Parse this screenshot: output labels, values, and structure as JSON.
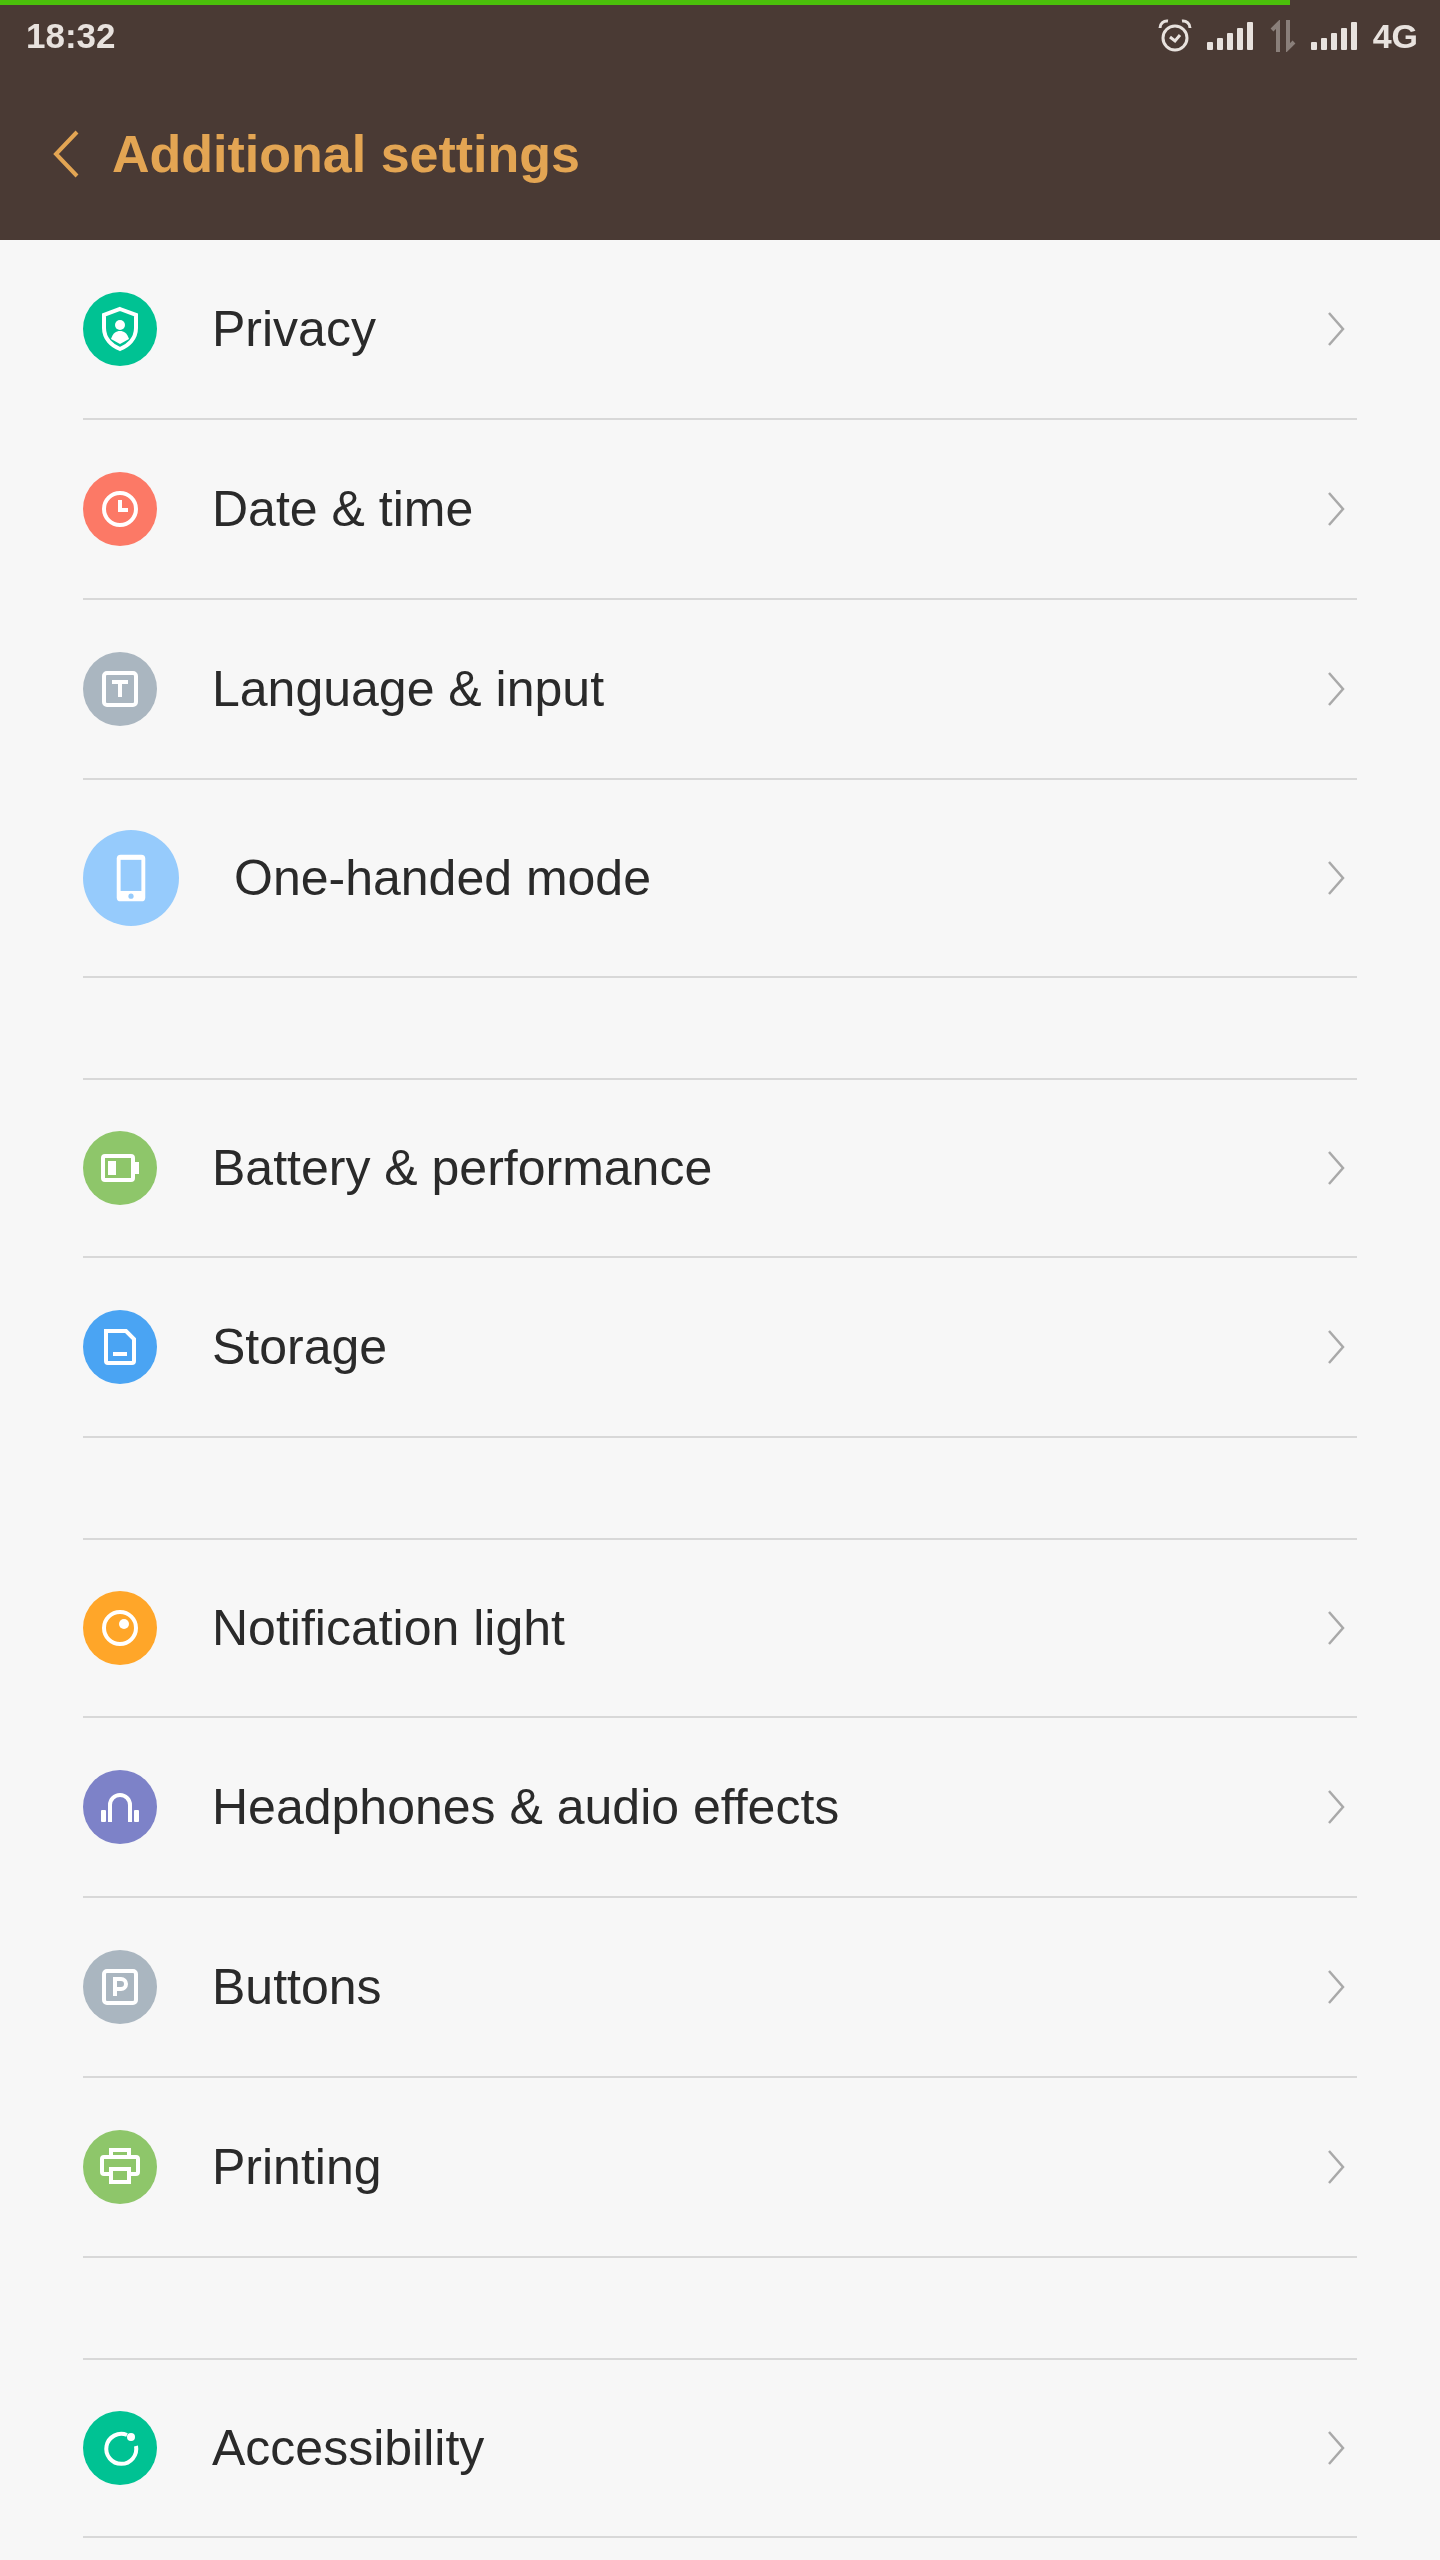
{
  "status_bar": {
    "time": "18:32",
    "network": "4G",
    "progress": {
      "level": 0.896
    }
  },
  "header": {
    "title": "Additional settings"
  },
  "groups": [
    {
      "items": [
        {
          "label": "Privacy",
          "color": "#00c293"
        },
        {
          "label": "Date & time",
          "color": "#fc7966"
        },
        {
          "label": "Language & input",
          "color": "#aab6c0"
        },
        {
          "label": "One-handed mode",
          "color": "#96cbfc"
        }
      ]
    },
    {
      "items": [
        {
          "label": "Battery & performance",
          "color": "#8ec66a"
        },
        {
          "label": "Storage",
          "color": "#4aa4f3"
        }
      ]
    },
    {
      "items": [
        {
          "label": "Notification light",
          "color": "#ffa629"
        },
        {
          "label": "Headphones & audio effects",
          "color": "#7d82c8"
        },
        {
          "label": "Buttons",
          "color": "#aab6c0"
        },
        {
          "label": "Printing",
          "color": "#8ec66a"
        }
      ]
    },
    {
      "items": [
        {
          "label": "Accessibility",
          "color": "#00c293"
        }
      ]
    }
  ]
}
